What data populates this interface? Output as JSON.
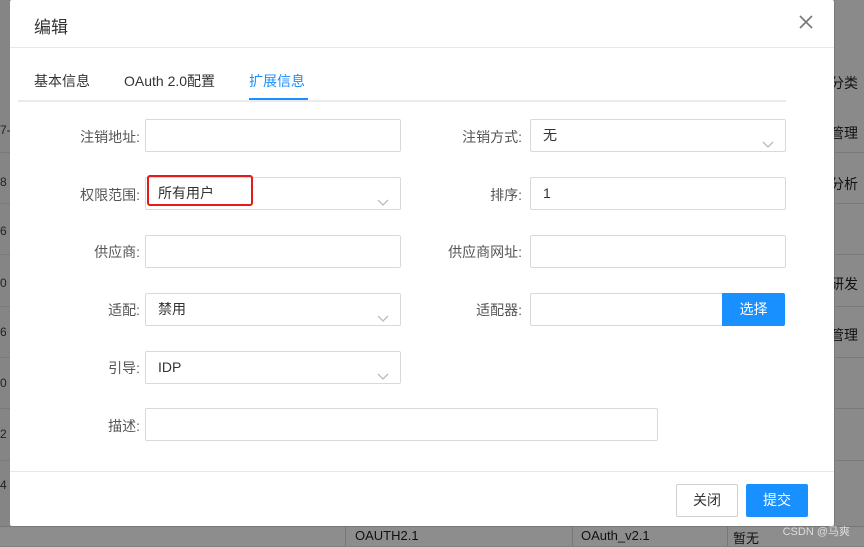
{
  "background": {
    "left_numbers": [
      "7-",
      "8",
      "6",
      "0",
      "6",
      "0",
      "2",
      "4"
    ],
    "right_texts": [
      "分类",
      "管理",
      "分析",
      "研发",
      "管理"
    ],
    "bottom_row": {
      "cell1": "OAUTH2.1",
      "cell2": "OAuth_v2.1",
      "cell3": "暂无"
    },
    "watermark": "CSDN @马爽"
  },
  "modal": {
    "title": "编辑",
    "tabs": [
      {
        "label": "基本信息",
        "active": false
      },
      {
        "label": "OAuth 2.0配置",
        "active": false
      },
      {
        "label": "扩展信息",
        "active": true
      }
    ],
    "form": {
      "logout_url": {
        "label": "注销地址:",
        "value": ""
      },
      "logout_method": {
        "label": "注销方式:",
        "value": "无"
      },
      "scope": {
        "label": "权限范围:",
        "value": "所有用户"
      },
      "sort": {
        "label": "排序:",
        "value": "1"
      },
      "provider": {
        "label": "供应商:",
        "value": ""
      },
      "provider_url": {
        "label": "供应商网址:",
        "value": ""
      },
      "adapt": {
        "label": "适配:",
        "value": "禁用"
      },
      "adapter": {
        "label": "适配器:",
        "value": "",
        "button": "选择"
      },
      "guide": {
        "label": "引导:",
        "value": "IDP"
      },
      "description": {
        "label": "描述:",
        "value": ""
      }
    },
    "footer": {
      "close_label": "关闭",
      "submit_label": "提交"
    },
    "colors": {
      "accent": "#1890ff",
      "highlight": "#e21b1b"
    }
  }
}
